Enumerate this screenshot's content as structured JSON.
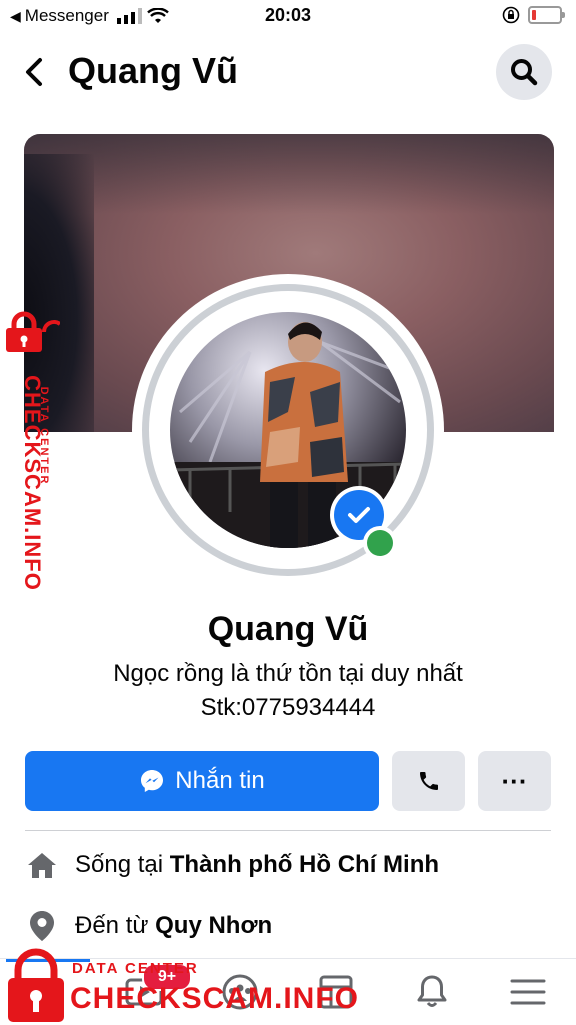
{
  "status_bar": {
    "back_app": "Messenger",
    "time": "20:03"
  },
  "header": {
    "title": "Quang Vũ"
  },
  "profile": {
    "name": "Quang Vũ",
    "bio_line1": "Ngọc rồng là thứ tồn tại duy nhất",
    "bio_line2": "Stk:0775934444",
    "verified": true,
    "online": true
  },
  "actions": {
    "message_label": "Nhắn tin",
    "more_label": "···"
  },
  "info": {
    "lives_prefix": "Sống tại",
    "lives_place": "Thành phố Hồ Chí Minh",
    "from_prefix": "Đến từ",
    "from_place": "Quy Nhơn"
  },
  "bottom_nav": {
    "items": [
      "home-icon",
      "watch-icon",
      "groups-icon",
      "pages-icon",
      "notifications-icon",
      "menu-icon"
    ],
    "watch_badge": "9+"
  },
  "watermark": {
    "text": "CHECKSCAM.INFO",
    "sub": "DATA CENTER"
  },
  "colors": {
    "accent": "#1877f2",
    "secondary_button": "#e4e6eb",
    "online": "#31a24c",
    "watermark": "#e4161b"
  }
}
